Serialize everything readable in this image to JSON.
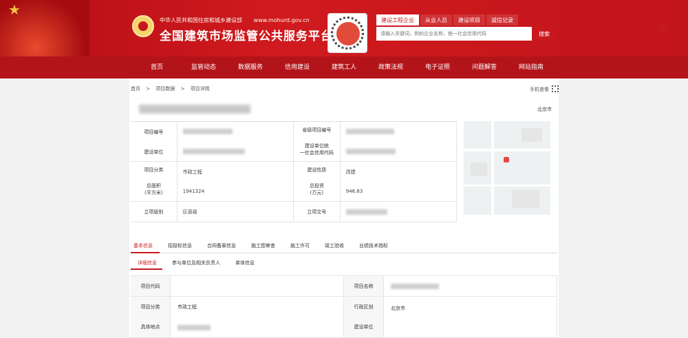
{
  "header": {
    "ministry": "中华人民共和国住房和城乡建设部",
    "url": "www.mohurd.gov.cn",
    "title": "全国建筑市场监管公共服务平台"
  },
  "search": {
    "tabs": [
      "建设工程企业",
      "从业人员",
      "建设项目",
      "诚信记录"
    ],
    "active_tab": 0,
    "placeholder": "请输入关键词，例如企业名称、统一社会信用代码",
    "button": "搜索"
  },
  "nav": [
    "首页",
    "监管动态",
    "数据服务",
    "信用建设",
    "建筑工人",
    "政策法规",
    "电子证照",
    "问题解答",
    "网站指南"
  ],
  "breadcrumb": [
    "首页",
    ">",
    "项目数据",
    ">",
    "项目详情"
  ],
  "share_label": "手机查看",
  "location": "北京市",
  "info": {
    "project_code_label": "项目编号",
    "provincial_code_label": "省级项目编号",
    "builder_label": "建设单位",
    "builder_credit_label1": "建设单位统",
    "builder_credit_label2": "一社会信用代码",
    "category_label": "项目分类",
    "category_value": "市政工程",
    "nature_label": "建设性质",
    "nature_value": "改建",
    "area_label1": "总面积",
    "area_label2": "(平方米)",
    "area_value": "1941324",
    "investment_label1": "总投资",
    "investment_label2": "(万元)",
    "investment_value": "946.83",
    "approval_level_label": "立项级别",
    "approval_level_value": "区县级",
    "approval_doc_label": "立项文号"
  },
  "main_tabs": [
    "基本信息",
    "招投标信息",
    "合同备案信息",
    "施工图审查",
    "施工许可",
    "竣工验收",
    "业绩技术指标"
  ],
  "main_active": 0,
  "sub_tabs": [
    "详细信息",
    "参与单位及相关负责人",
    "单体信息"
  ],
  "sub_active": 0,
  "detail": {
    "project_code_label": "项目代码",
    "project_code_value": "",
    "project_name_label": "项目名称",
    "category_label": "项目分类",
    "category_value": "市政工程",
    "region_label": "行政区划",
    "region_value": "北京市",
    "address_label": "具体地点",
    "builder_label": "建设单位"
  }
}
